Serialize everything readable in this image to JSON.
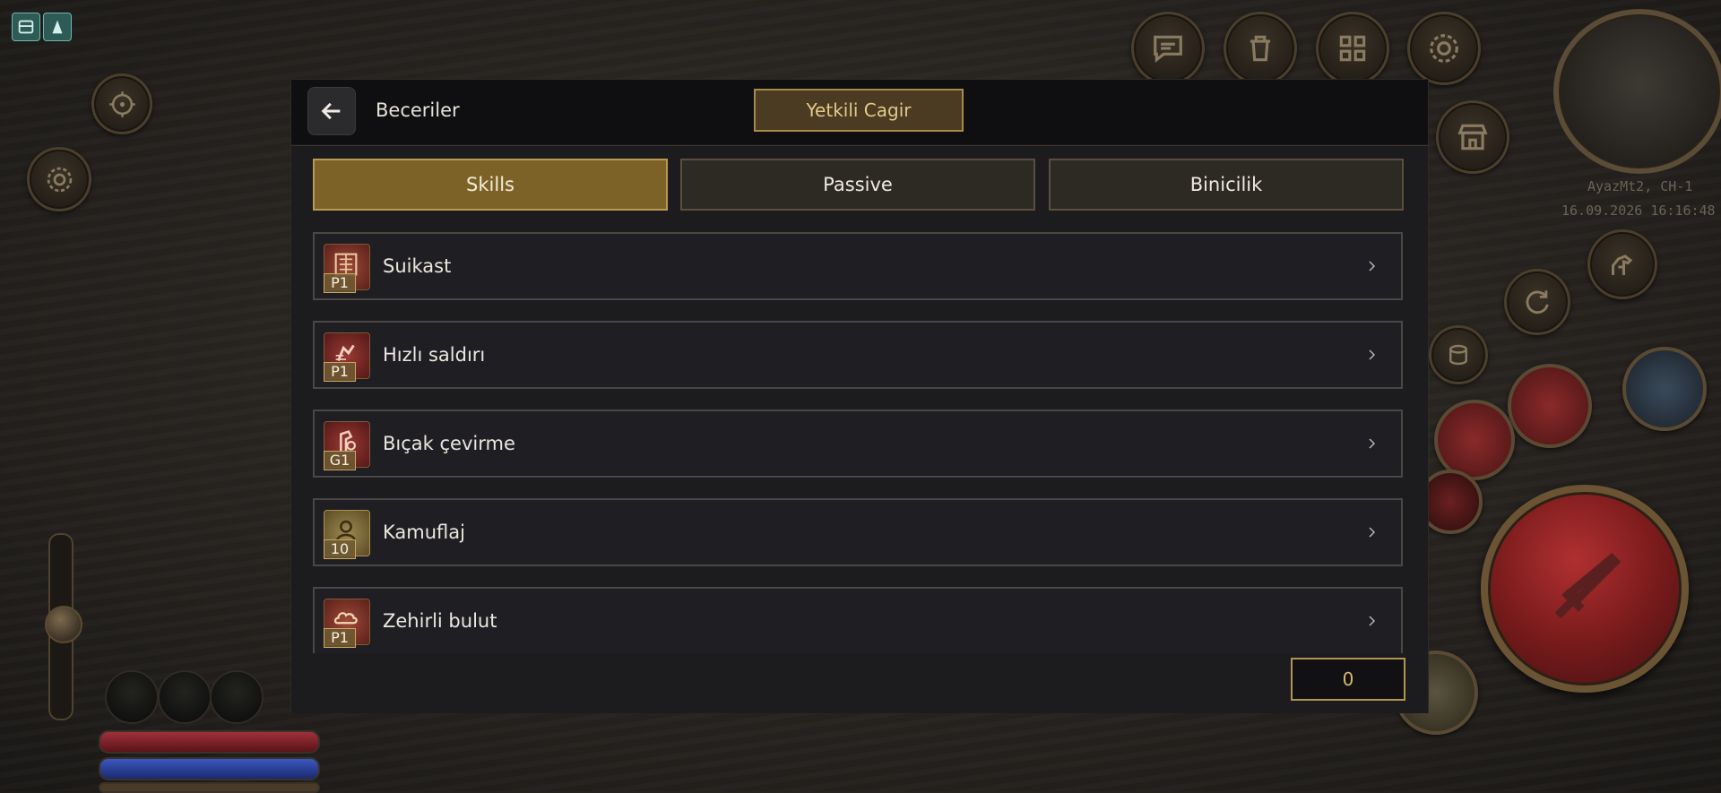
{
  "dialog": {
    "title": "Beceriler",
    "call_button": "Yetkili Cagir",
    "tabs": [
      {
        "label": "Skills",
        "active": true
      },
      {
        "label": "Passive",
        "active": false
      },
      {
        "label": "Binicilik",
        "active": false
      }
    ],
    "skills": [
      {
        "name": "Suikast",
        "badge": "P1",
        "icon": "assassinate-icon"
      },
      {
        "name": "Hızlı saldırı",
        "badge": "P1",
        "icon": "fast-attack-icon"
      },
      {
        "name": "Bıçak çevirme",
        "badge": "G1",
        "icon": "knife-twist-icon"
      },
      {
        "name": "Kamuflaj",
        "badge": "10",
        "icon": "camouflage-icon"
      },
      {
        "name": "Zehirli bulut",
        "badge": "P1",
        "icon": "poison-cloud-icon"
      }
    ],
    "skill_points": "0"
  },
  "minimap": {
    "server": "AyazMt2, CH-1",
    "datetime": "16.09.2026 16:16:48"
  },
  "hud_icons": [
    "chat-icon",
    "trash-icon",
    "grid-icon",
    "settings-icon",
    "shop-icon",
    "horse-icon",
    "refresh-icon",
    "coins-icon",
    "target-icon",
    "sword-icon"
  ],
  "colors": {
    "accent_gold": "#b89a55",
    "active_tab": "#7d6228",
    "attack_red": "#7a1b1c"
  }
}
